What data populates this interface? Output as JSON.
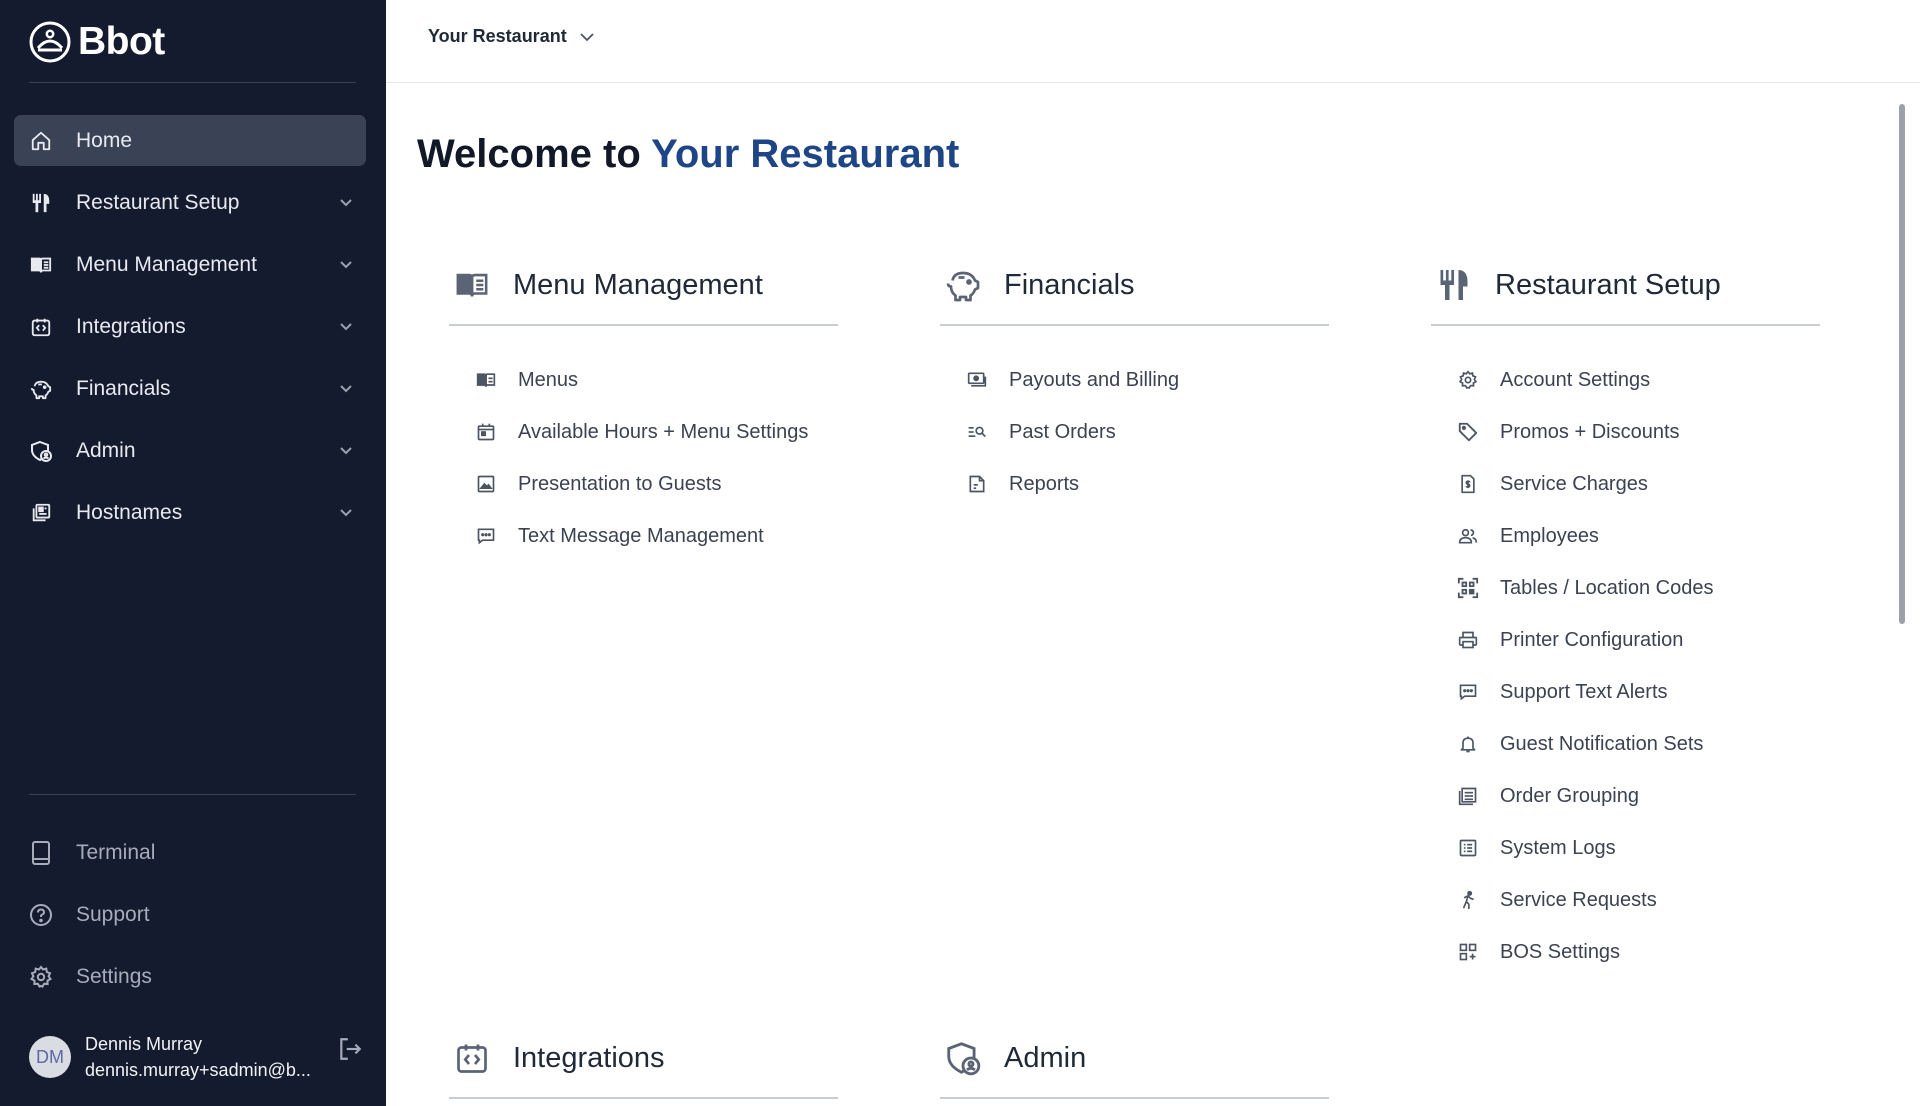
{
  "app": {
    "logo_text": "Bbot"
  },
  "sidebar": {
    "items": [
      {
        "label": "Home",
        "icon": "home-icon",
        "active": true
      },
      {
        "label": "Restaurant Setup",
        "icon": "utensils-icon"
      },
      {
        "label": "Menu Management",
        "icon": "menu-book-icon"
      },
      {
        "label": "Integrations",
        "icon": "integrations-icon"
      },
      {
        "label": "Financials",
        "icon": "piggy-bank-icon"
      },
      {
        "label": "Admin",
        "icon": "admin-shield-icon"
      },
      {
        "label": "Hostnames",
        "icon": "hostnames-icon"
      }
    ],
    "bottom_items": [
      {
        "label": "Terminal",
        "icon": "tablet-icon"
      },
      {
        "label": "Support",
        "icon": "help-circle-icon"
      },
      {
        "label": "Settings",
        "icon": "gear-icon"
      }
    ],
    "user": {
      "initials": "DM",
      "name": "Dennis Murray",
      "email": "dennis.murray+sadmin@b..."
    }
  },
  "header": {
    "restaurant_select": "Your Restaurant"
  },
  "main": {
    "welcome_prefix": "Welcome to ",
    "welcome_name": "Your Restaurant",
    "cards": [
      {
        "title": "Menu Management",
        "icon": "menu-book-icon",
        "links": [
          {
            "label": "Menus",
            "icon": "menu-book-icon"
          },
          {
            "label": "Available Hours + Menu Settings",
            "icon": "calendar-icon"
          },
          {
            "label": "Presentation to Guests",
            "icon": "image-icon"
          },
          {
            "label": "Text Message Management",
            "icon": "message-icon"
          }
        ]
      },
      {
        "title": "Financials",
        "icon": "piggy-bank-icon",
        "links": [
          {
            "label": "Payouts and Billing",
            "icon": "money-icon"
          },
          {
            "label": "Past Orders",
            "icon": "search-list-icon"
          },
          {
            "label": "Reports",
            "icon": "report-icon"
          }
        ]
      },
      {
        "title": "Restaurant Setup",
        "icon": "utensils-icon",
        "links": [
          {
            "label": "Account Settings",
            "icon": "gear-icon"
          },
          {
            "label": "Promos + Discounts",
            "icon": "tag-icon"
          },
          {
            "label": "Service Charges",
            "icon": "invoice-icon"
          },
          {
            "label": "Employees",
            "icon": "users-icon"
          },
          {
            "label": "Tables / Location Codes",
            "icon": "qr-scan-icon"
          },
          {
            "label": "Printer Configuration",
            "icon": "printer-icon"
          },
          {
            "label": "Support Text Alerts",
            "icon": "message-icon"
          },
          {
            "label": "Guest Notification Sets",
            "icon": "bell-icon"
          },
          {
            "label": "Order Grouping",
            "icon": "group-icon"
          },
          {
            "label": "System Logs",
            "icon": "list-icon"
          },
          {
            "label": "Service Requests",
            "icon": "runner-icon"
          },
          {
            "label": "BOS Settings",
            "icon": "grid-plus-icon"
          }
        ]
      },
      {
        "title": "Integrations",
        "icon": "integrations-icon",
        "links": []
      },
      {
        "title": "Admin",
        "icon": "admin-shield-icon",
        "links": []
      }
    ]
  }
}
